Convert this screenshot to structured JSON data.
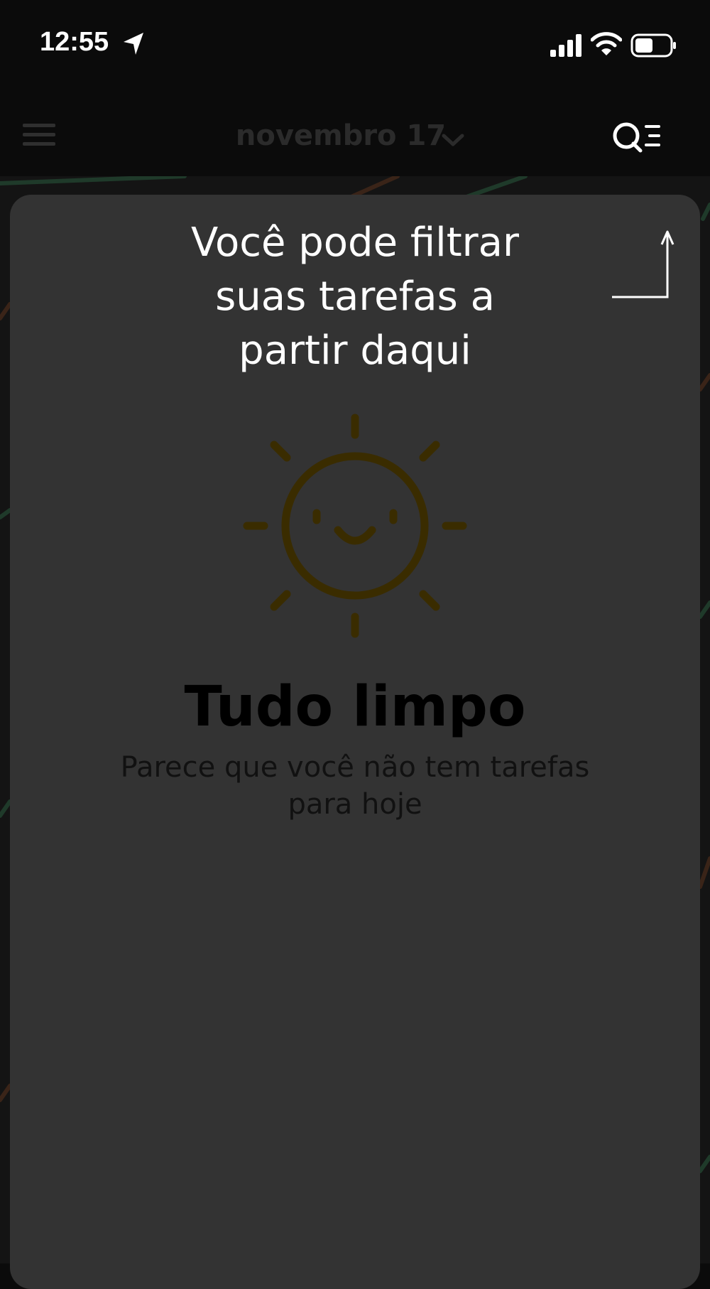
{
  "status_bar": {
    "time": "12:55",
    "icons": [
      "location-arrow-icon",
      "cellular-signal-icon",
      "wifi-icon",
      "battery-icon"
    ]
  },
  "header": {
    "date_label": "novembro 17",
    "menu_icon": "hamburger-menu-icon",
    "dropdown_icon": "chevron-down-icon",
    "filter_icon": "search-filter-icon"
  },
  "onboarding_tooltip": {
    "line1": "Você pode filtrar",
    "line2": "suas tarefas a",
    "line3": "partir daqui"
  },
  "empty_state": {
    "icon": "smiling-sun-icon",
    "title": "Tudo limpo",
    "subtitle_line1": "Parece que você não tem tarefas",
    "subtitle_line2": "para hoje"
  },
  "colors": {
    "background": "#0b0b0b",
    "sheet": "#333333",
    "sun": "#3a2c00",
    "tooltip_text": "#ffffff"
  }
}
